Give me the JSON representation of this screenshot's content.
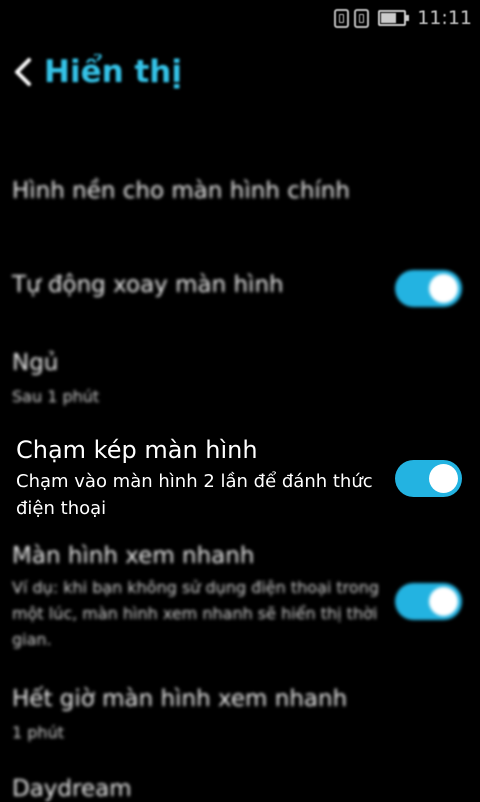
{
  "status_bar": {
    "time": "11:11",
    "icons": [
      "sim1-icon",
      "sim2-icon",
      "battery-icon"
    ]
  },
  "header": {
    "back_icon": "chevron-left-icon",
    "title": "Hiển thị"
  },
  "settings": [
    {
      "id": "wallpaper",
      "title": "Hình nền cho màn hình chính"
    },
    {
      "id": "auto-rotate",
      "title": "Tự động xoay màn hình",
      "toggle": true
    },
    {
      "id": "sleep",
      "title": "Ngủ",
      "subtitle": "Sau 1 phút"
    },
    {
      "id": "double-tap",
      "title": "Chạm kép màn hình",
      "subtitle": "Chạm vào màn hình 2 lần để đánh thức điện thoại",
      "toggle": true
    },
    {
      "id": "glance",
      "title": "Màn hình xem nhanh",
      "subtitle": "Ví dụ: khi bạn không sử dụng điện thoại trong một lúc, màn hình xem nhanh sẽ hiển thị thời gian.",
      "toggle": true
    },
    {
      "id": "glance-timeout",
      "title": "Hết giờ màn hình xem nhanh",
      "subtitle": "1 phút"
    },
    {
      "id": "daydream",
      "title": "Daydream"
    }
  ],
  "colors": {
    "accent": "#35c3e8",
    "toggle_on": "#23b3e1",
    "background": "#000000"
  }
}
